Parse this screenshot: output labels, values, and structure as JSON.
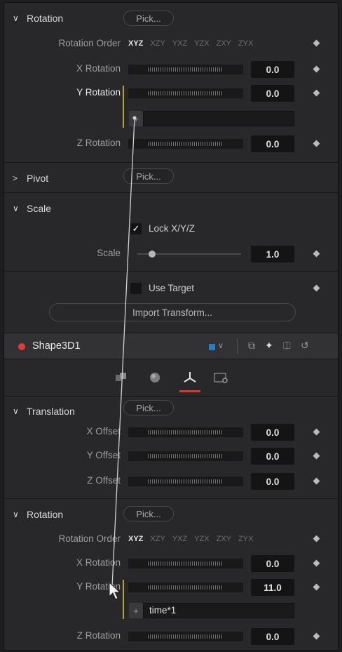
{
  "rotation_top": {
    "title": "Rotation",
    "pick_label": "Pick...",
    "order_label": "Rotation Order",
    "orders": [
      "XYZ",
      "XZY",
      "YXZ",
      "YZX",
      "ZXY",
      "ZYX"
    ],
    "x_label": "X Rotation",
    "x_value": "0.0",
    "y_label": "Y Rotation",
    "y_value": "0.0",
    "y_plus": "+",
    "y_expression": "",
    "z_label": "Z Rotation",
    "z_value": "0.0"
  },
  "pivot": {
    "title": "Pivot",
    "pick_label": "Pick..."
  },
  "scale": {
    "title": "Scale",
    "lock_label": "Lock X/Y/Z",
    "lock_checked": true,
    "scale_label": "Scale",
    "scale_value": "1.0"
  },
  "use_target": {
    "label": "Use Target",
    "checked": false
  },
  "import_transform": {
    "label": "Import Transform..."
  },
  "node": {
    "name": "Shape3D1",
    "color": "#2f7bbf"
  },
  "translation": {
    "title": "Translation",
    "pick_label": "Pick...",
    "x_label": "X Offset",
    "x_value": "0.0",
    "y_label": "Y Offset",
    "y_value": "0.0",
    "z_label": "Z Offset",
    "z_value": "0.0"
  },
  "rotation_bottom": {
    "title": "Rotation",
    "pick_label": "Pick...",
    "order_label": "Rotation Order",
    "orders": [
      "XYZ",
      "XZY",
      "YXZ",
      "YZX",
      "ZXY",
      "ZYX"
    ],
    "x_label": "X Rotation",
    "x_value": "0.0",
    "y_label": "Y Rotation",
    "y_value": "11.0",
    "y_plus": "+",
    "y_expression": "time*1",
    "z_label": "Z Rotation",
    "z_value": "0.0"
  },
  "colors": {
    "accent_red": "#d33a2c",
    "expression_bar": "#b99f3a"
  }
}
